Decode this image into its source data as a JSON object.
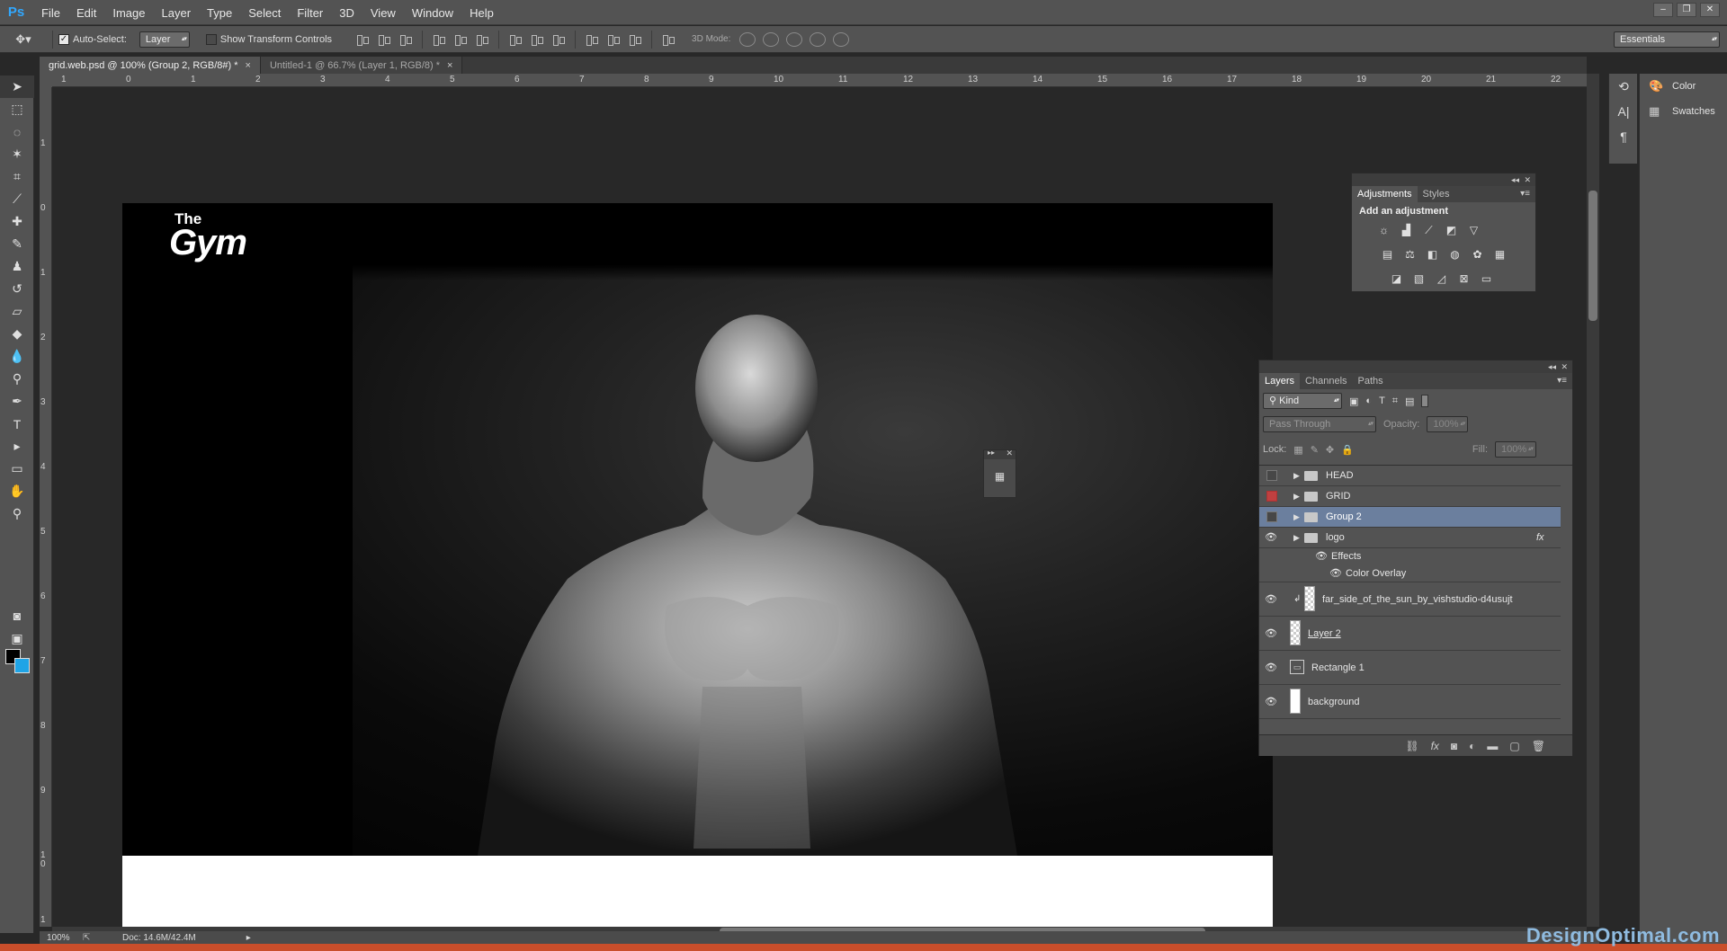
{
  "app": {
    "logo": "Ps"
  },
  "menu": [
    "File",
    "Edit",
    "Image",
    "Layer",
    "Type",
    "Select",
    "Filter",
    "3D",
    "View",
    "Window",
    "Help"
  ],
  "window_controls": [
    "–",
    "❐",
    "✕"
  ],
  "options": {
    "auto_select_label": "Auto-Select:",
    "auto_select_checked": true,
    "auto_select_target": "Layer",
    "show_transform_label": "Show Transform Controls",
    "three_d_mode_label": "3D Mode:",
    "workspace": "Essentials"
  },
  "tabs": [
    {
      "label": "grid.web.psd @ 100% (Group 2, RGB/8#) *",
      "active": true
    },
    {
      "label": "Untitled-1 @ 66.7% (Layer 1, RGB/8) *",
      "active": false
    }
  ],
  "ruler_h": [
    "1",
    "0",
    "1",
    "2",
    "3",
    "4",
    "5",
    "6",
    "7",
    "8",
    "9",
    "10",
    "11",
    "12",
    "13",
    "14",
    "15",
    "16",
    "17",
    "18",
    "19",
    "20",
    "21",
    "22"
  ],
  "ruler_v": [
    "1",
    "0",
    "1",
    "2",
    "3",
    "4",
    "5",
    "6",
    "7",
    "8",
    "9",
    "1\n0",
    "1"
  ],
  "document": {
    "logo_small": "The",
    "logo_large": "Gym"
  },
  "adjustments": {
    "tabs": [
      "Adjustments",
      "Styles"
    ],
    "title": "Add an adjustment"
  },
  "layers": {
    "tabs": [
      "Layers",
      "Channels",
      "Paths"
    ],
    "filter_kind": "Kind",
    "blend_mode": "Pass Through",
    "opacity_label": "Opacity:",
    "opacity_value": "100%",
    "lock_label": "Lock:",
    "fill_label": "Fill:",
    "fill_value": "100%",
    "items": [
      {
        "name": "HEAD",
        "type": "group",
        "visible": false
      },
      {
        "name": "GRID",
        "type": "group",
        "visible": false,
        "color": "red"
      },
      {
        "name": "Group 2",
        "type": "group",
        "visible": false,
        "selected": true
      },
      {
        "name": "logo",
        "type": "group",
        "visible": true,
        "fx": "fx"
      },
      {
        "name": "Effects",
        "type": "effect",
        "visible": true
      },
      {
        "name": "Color Overlay",
        "type": "effect",
        "visible": true
      },
      {
        "name": "far_side_of_the_sun_by_vishstudio-d4usujt",
        "type": "layer",
        "visible": true
      },
      {
        "name": "Layer 2",
        "type": "layer",
        "visible": true
      },
      {
        "name": "Rectangle 1",
        "type": "shape",
        "visible": true
      },
      {
        "name": "background",
        "type": "layer",
        "visible": true
      }
    ]
  },
  "dock": {
    "items": [
      "Color",
      "Swatches"
    ]
  },
  "status": {
    "zoom": "100%",
    "doc": "Doc: 14.6M/42.4M"
  },
  "watermark": "DesignOptimal.com"
}
